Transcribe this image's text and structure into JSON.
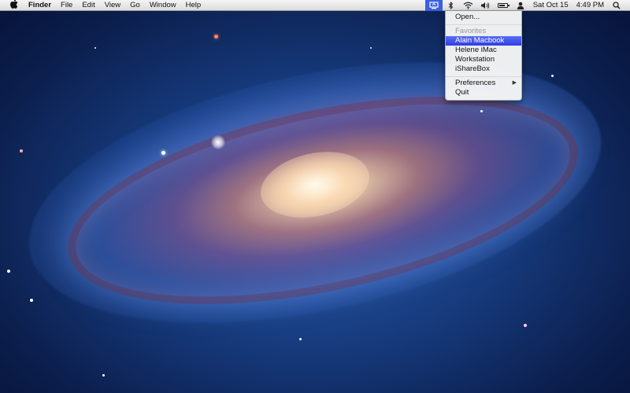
{
  "menubar": {
    "apple_icon": "",
    "app_name": "Finder",
    "menus": [
      "File",
      "Edit",
      "View",
      "Go",
      "Window",
      "Help"
    ],
    "status": {
      "active_app_icon": "ishare-menu-icon",
      "bluetooth_icon": "bluetooth-icon",
      "wifi_icon": "wifi-icon",
      "volume_icon": "volume-icon",
      "battery_icon": "battery-icon",
      "user_icon": "user-icon",
      "date": "Sat Oct 15",
      "time": "4:49 PM",
      "spotlight_icon": "spotlight-icon"
    }
  },
  "dropdown": {
    "open_label": "Open...",
    "favorites_header": "Favorites",
    "favorites": [
      "Alain Macbook",
      "Helene iMac",
      "Workstation",
      "iShareBox"
    ],
    "selected_favorite": "Alain Macbook",
    "preferences_label": "Preferences",
    "quit_label": "Quit"
  },
  "colors": {
    "highlight": "#3a4ee8",
    "menubar": "#e8e8e8"
  }
}
